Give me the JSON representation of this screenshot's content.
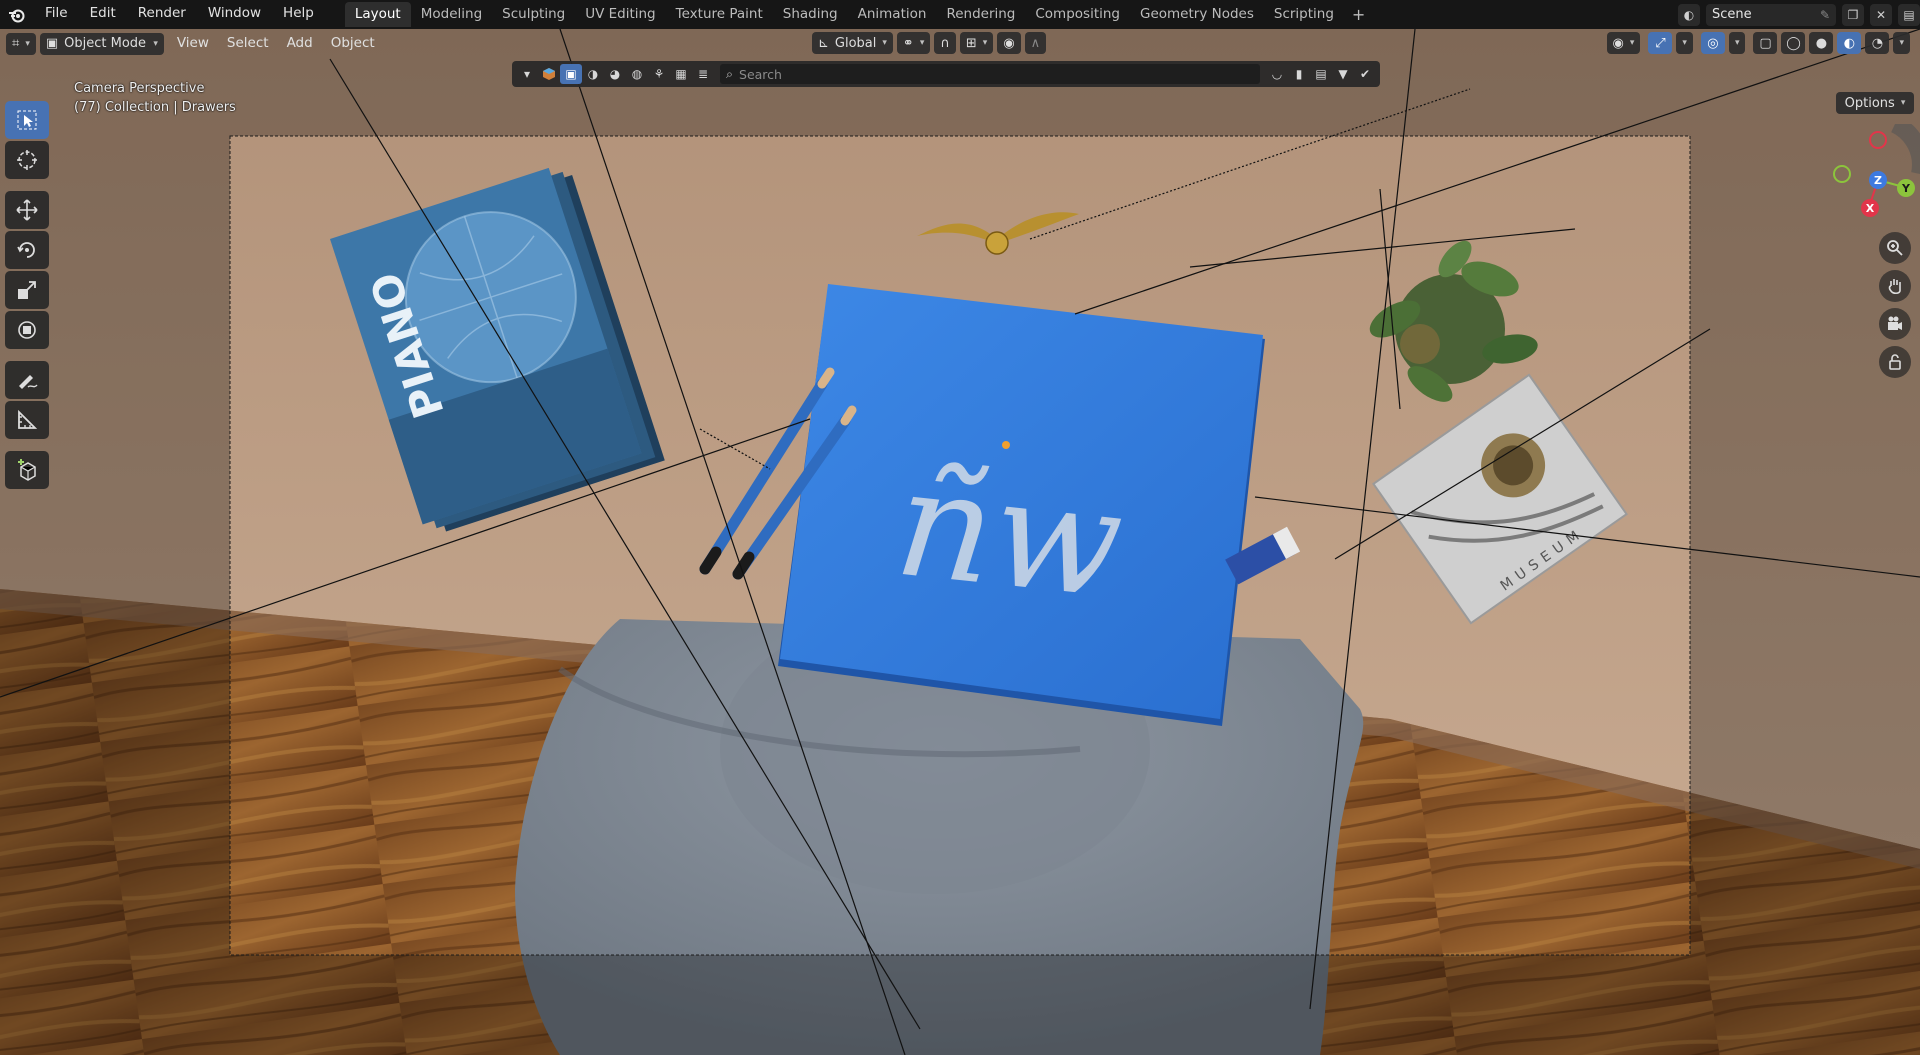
{
  "menubar": {
    "items": [
      "File",
      "Edit",
      "Render",
      "Window",
      "Help"
    ],
    "workspaces": [
      "Layout",
      "Modeling",
      "Sculpting",
      "UV Editing",
      "Texture Paint",
      "Shading",
      "Animation",
      "Rendering",
      "Compositing",
      "Geometry Nodes",
      "Scripting"
    ],
    "active_workspace": "Layout",
    "add_workspace": "+",
    "scene_name": "Scene"
  },
  "viewport_header": {
    "mode": "Object Mode",
    "menus": [
      "View",
      "Select",
      "Add",
      "Object"
    ],
    "transform_orientation": "Global"
  },
  "filter_bar": {
    "search_placeholder": "Search"
  },
  "options_label": "Options",
  "overlay": {
    "line1": "Camera Perspective",
    "line2": "(77) Collection | Drawers"
  },
  "gizmo": {
    "z_label": "Z",
    "y_label": "Y",
    "x_label": "X"
  },
  "scene_text": {
    "magazine_title": "PIANO",
    "book_title": "MUSEUM",
    "tablet_logo": "ñw"
  },
  "colors": {
    "accent": "#4772b3",
    "topbar": "#161616",
    "axis_x": "#e2354a",
    "axis_y": "#8cc43c",
    "axis_z": "#3d7ae0"
  }
}
